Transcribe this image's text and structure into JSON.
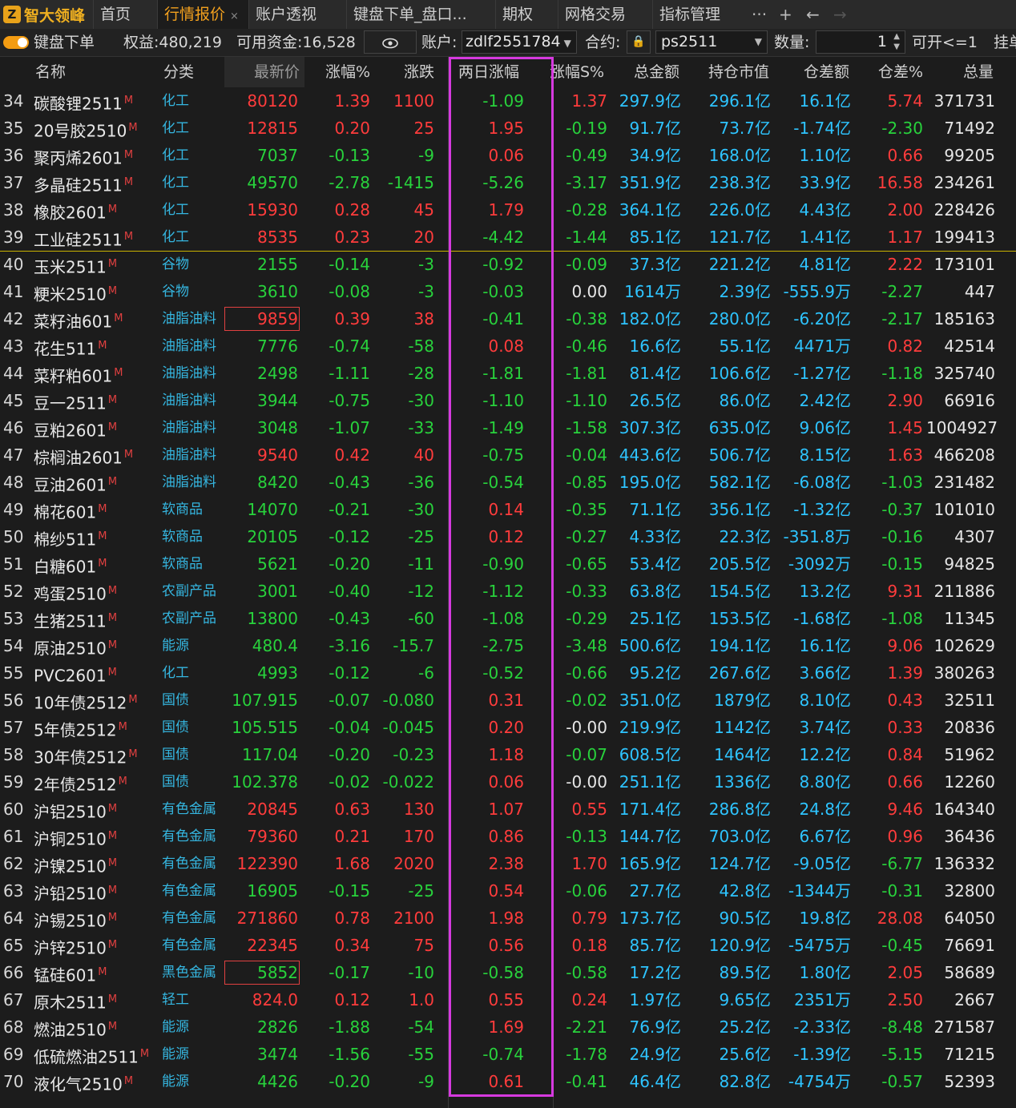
{
  "app": {
    "logo_text": "智大领峰",
    "logo_badge": "Z"
  },
  "tabs": [
    {
      "label": "首页"
    },
    {
      "label": "行情报价",
      "active": true,
      "close": "×"
    },
    {
      "label": "账户透视"
    },
    {
      "label": "键盘下单_盘口..."
    },
    {
      "label": "期权"
    },
    {
      "label": "网格交易"
    },
    {
      "label": "指标管理"
    }
  ],
  "tab_icons": {
    "more": "···",
    "add": "+",
    "back": "←",
    "forward": "→"
  },
  "toolbar": {
    "mode_label": "键盘下单",
    "equity_label": "权益:480,219",
    "available_label": "可用资金:16,528",
    "account_label": "账户:",
    "account_value": "zdlf2551784",
    "contract_label": "合约:",
    "contract_value": "ps2511",
    "qty_label": "数量:",
    "qty_value": "1",
    "open_label": "可开<=1",
    "pending_label": "挂单"
  },
  "columns": [
    "名称",
    "分类",
    "最新价",
    "涨幅%",
    "涨跌",
    "两日涨幅",
    "涨幅S%",
    "总金额",
    "持仓市值",
    "仓差额",
    "仓差%",
    "总量"
  ],
  "rows": [
    {
      "n": "34",
      "name": "碳酸锂2511",
      "m": "M",
      "cat": "化工",
      "price": "80120",
      "pct": "1.39",
      "chg": "1100",
      "two": "-1.09",
      "s": "1.37",
      "amt": "297.9亿",
      "pos": "296.1亿",
      "diff": "16.1亿",
      "dpct": "5.74",
      "vol": "371731"
    },
    {
      "n": "35",
      "name": "20号胶2510",
      "m": "M",
      "cat": "化工",
      "price": "12815",
      "pct": "0.20",
      "chg": "25",
      "two": "1.95",
      "s": "-0.19",
      "amt": "91.7亿",
      "pos": "73.7亿",
      "diff": "-1.74亿",
      "dpct": "-2.30",
      "vol": "71492"
    },
    {
      "n": "36",
      "name": "聚丙烯2601",
      "m": "M",
      "cat": "化工",
      "price": "7037",
      "pct": "-0.13",
      "chg": "-9",
      "two": "0.06",
      "s": "-0.49",
      "amt": "34.9亿",
      "pos": "168.0亿",
      "diff": "1.10亿",
      "dpct": "0.66",
      "vol": "99205"
    },
    {
      "n": "37",
      "name": "多晶硅2511",
      "m": "M",
      "cat": "化工",
      "price": "49570",
      "pct": "-2.78",
      "chg": "-1415",
      "two": "-5.26",
      "s": "-3.17",
      "amt": "351.9亿",
      "pos": "238.3亿",
      "diff": "33.9亿",
      "dpct": "16.58",
      "vol": "234261"
    },
    {
      "n": "38",
      "name": "橡胶2601",
      "m": "M",
      "cat": "化工",
      "price": "15930",
      "pct": "0.28",
      "chg": "45",
      "two": "1.79",
      "s": "-0.28",
      "amt": "364.1亿",
      "pos": "226.0亿",
      "diff": "4.43亿",
      "dpct": "2.00",
      "vol": "228426"
    },
    {
      "n": "39",
      "name": "工业硅2511",
      "m": "M",
      "cat": "化工",
      "price": "8535",
      "pct": "0.23",
      "chg": "20",
      "two": "-4.42",
      "s": "-1.44",
      "amt": "85.1亿",
      "pos": "121.7亿",
      "diff": "1.41亿",
      "dpct": "1.17",
      "vol": "199413"
    },
    {
      "n": "40",
      "name": "玉米2511",
      "m": "M",
      "cat": "谷物",
      "price": "2155",
      "pct": "-0.14",
      "chg": "-3",
      "two": "-0.92",
      "s": "-0.09",
      "amt": "37.3亿",
      "pos": "221.2亿",
      "diff": "4.81亿",
      "dpct": "2.22",
      "vol": "173101"
    },
    {
      "n": "41",
      "name": "粳米2510",
      "m": "M",
      "cat": "谷物",
      "price": "3610",
      "pct": "-0.08",
      "chg": "-3",
      "two": "-0.03",
      "s": "0.00",
      "amt": "1614万",
      "pos": "2.39亿",
      "diff": "-555.9万",
      "dpct": "-2.27",
      "vol": "447"
    },
    {
      "n": "42",
      "name": "菜籽油601",
      "m": "M",
      "cat": "油脂油料",
      "price": "9859",
      "pct": "0.39",
      "chg": "38",
      "two": "-0.41",
      "s": "-0.38",
      "amt": "182.0亿",
      "pos": "280.0亿",
      "diff": "-6.20亿",
      "dpct": "-2.17",
      "vol": "185163"
    },
    {
      "n": "43",
      "name": "花生511",
      "m": "M",
      "cat": "油脂油料",
      "price": "7776",
      "pct": "-0.74",
      "chg": "-58",
      "two": "0.08",
      "s": "-0.46",
      "amt": "16.6亿",
      "pos": "55.1亿",
      "diff": "4471万",
      "dpct": "0.82",
      "vol": "42514"
    },
    {
      "n": "44",
      "name": "菜籽粕601",
      "m": "M",
      "cat": "油脂油料",
      "price": "2498",
      "pct": "-1.11",
      "chg": "-28",
      "two": "-1.81",
      "s": "-1.81",
      "amt": "81.4亿",
      "pos": "106.6亿",
      "diff": "-1.27亿",
      "dpct": "-1.18",
      "vol": "325740"
    },
    {
      "n": "45",
      "name": "豆一2511",
      "m": "M",
      "cat": "油脂油料",
      "price": "3944",
      "pct": "-0.75",
      "chg": "-30",
      "two": "-1.10",
      "s": "-1.10",
      "amt": "26.5亿",
      "pos": "86.0亿",
      "diff": "2.42亿",
      "dpct": "2.90",
      "vol": "66916"
    },
    {
      "n": "46",
      "name": "豆粕2601",
      "m": "M",
      "cat": "油脂油料",
      "price": "3048",
      "pct": "-1.07",
      "chg": "-33",
      "two": "-1.49",
      "s": "-1.58",
      "amt": "307.3亿",
      "pos": "635.0亿",
      "diff": "9.06亿",
      "dpct": "1.45",
      "vol": "1004927"
    },
    {
      "n": "47",
      "name": "棕榈油2601",
      "m": "M",
      "cat": "油脂油料",
      "price": "9540",
      "pct": "0.42",
      "chg": "40",
      "two": "-0.75",
      "s": "-0.04",
      "amt": "443.6亿",
      "pos": "506.7亿",
      "diff": "8.15亿",
      "dpct": "1.63",
      "vol": "466208"
    },
    {
      "n": "48",
      "name": "豆油2601",
      "m": "M",
      "cat": "油脂油料",
      "price": "8420",
      "pct": "-0.43",
      "chg": "-36",
      "two": "-0.54",
      "s": "-0.85",
      "amt": "195.0亿",
      "pos": "582.1亿",
      "diff": "-6.08亿",
      "dpct": "-1.03",
      "vol": "231482"
    },
    {
      "n": "49",
      "name": "棉花601",
      "m": "M",
      "cat": "软商品",
      "price": "14070",
      "pct": "-0.21",
      "chg": "-30",
      "two": "0.14",
      "s": "-0.35",
      "amt": "71.1亿",
      "pos": "356.1亿",
      "diff": "-1.32亿",
      "dpct": "-0.37",
      "vol": "101010"
    },
    {
      "n": "50",
      "name": "棉纱511",
      "m": "M",
      "cat": "软商品",
      "price": "20105",
      "pct": "-0.12",
      "chg": "-25",
      "two": "0.12",
      "s": "-0.27",
      "amt": "4.33亿",
      "pos": "22.3亿",
      "diff": "-351.8万",
      "dpct": "-0.16",
      "vol": "4307"
    },
    {
      "n": "51",
      "name": "白糖601",
      "m": "M",
      "cat": "软商品",
      "price": "5621",
      "pct": "-0.20",
      "chg": "-11",
      "two": "-0.90",
      "s": "-0.65",
      "amt": "53.4亿",
      "pos": "205.5亿",
      "diff": "-3092万",
      "dpct": "-0.15",
      "vol": "94825"
    },
    {
      "n": "52",
      "name": "鸡蛋2510",
      "m": "M",
      "cat": "农副产品",
      "price": "3001",
      "pct": "-0.40",
      "chg": "-12",
      "two": "-1.12",
      "s": "-0.33",
      "amt": "63.8亿",
      "pos": "154.5亿",
      "diff": "13.2亿",
      "dpct": "9.31",
      "vol": "211886"
    },
    {
      "n": "53",
      "name": "生猪2511",
      "m": "M",
      "cat": "农副产品",
      "price": "13800",
      "pct": "-0.43",
      "chg": "-60",
      "two": "-1.08",
      "s": "-0.29",
      "amt": "25.1亿",
      "pos": "153.5亿",
      "diff": "-1.68亿",
      "dpct": "-1.08",
      "vol": "11345"
    },
    {
      "n": "54",
      "name": "原油2510",
      "m": "M",
      "cat": "能源",
      "price": "480.4",
      "pct": "-3.16",
      "chg": "-15.7",
      "two": "-2.75",
      "s": "-3.48",
      "amt": "500.6亿",
      "pos": "194.1亿",
      "diff": "16.1亿",
      "dpct": "9.06",
      "vol": "102629"
    },
    {
      "n": "55",
      "name": "PVC2601",
      "m": "M",
      "cat": "化工",
      "price": "4993",
      "pct": "-0.12",
      "chg": "-6",
      "two": "-0.52",
      "s": "-0.66",
      "amt": "95.2亿",
      "pos": "267.6亿",
      "diff": "3.66亿",
      "dpct": "1.39",
      "vol": "380263"
    },
    {
      "n": "56",
      "name": "10年债2512",
      "m": "M",
      "cat": "国债",
      "price": "107.915",
      "pct": "-0.07",
      "chg": "-0.080",
      "two": "0.31",
      "s": "-0.02",
      "amt": "351.0亿",
      "pos": "1879亿",
      "diff": "8.10亿",
      "dpct": "0.43",
      "vol": "32511"
    },
    {
      "n": "57",
      "name": "5年债2512",
      "m": "M",
      "cat": "国债",
      "price": "105.515",
      "pct": "-0.04",
      "chg": "-0.045",
      "two": "0.20",
      "s": "-0.00",
      "amt": "219.9亿",
      "pos": "1142亿",
      "diff": "3.74亿",
      "dpct": "0.33",
      "vol": "20836"
    },
    {
      "n": "58",
      "name": "30年债2512",
      "m": "M",
      "cat": "国债",
      "price": "117.04",
      "pct": "-0.20",
      "chg": "-0.23",
      "two": "1.18",
      "s": "-0.07",
      "amt": "608.5亿",
      "pos": "1464亿",
      "diff": "12.2亿",
      "dpct": "0.84",
      "vol": "51962"
    },
    {
      "n": "59",
      "name": "2年债2512",
      "m": "M",
      "cat": "国债",
      "price": "102.378",
      "pct": "-0.02",
      "chg": "-0.022",
      "two": "0.06",
      "s": "-0.00",
      "amt": "251.1亿",
      "pos": "1336亿",
      "diff": "8.80亿",
      "dpct": "0.66",
      "vol": "12260"
    },
    {
      "n": "60",
      "name": "沪铝2510",
      "m": "M",
      "cat": "有色金属",
      "price": "20845",
      "pct": "0.63",
      "chg": "130",
      "two": "1.07",
      "s": "0.55",
      "amt": "171.4亿",
      "pos": "286.8亿",
      "diff": "24.8亿",
      "dpct": "9.46",
      "vol": "164340"
    },
    {
      "n": "61",
      "name": "沪铜2510",
      "m": "M",
      "cat": "有色金属",
      "price": "79360",
      "pct": "0.21",
      "chg": "170",
      "two": "0.86",
      "s": "-0.13",
      "amt": "144.7亿",
      "pos": "703.0亿",
      "diff": "6.67亿",
      "dpct": "0.96",
      "vol": "36436"
    },
    {
      "n": "62",
      "name": "沪镍2510",
      "m": "M",
      "cat": "有色金属",
      "price": "122390",
      "pct": "1.68",
      "chg": "2020",
      "two": "2.38",
      "s": "1.70",
      "amt": "165.9亿",
      "pos": "124.7亿",
      "diff": "-9.05亿",
      "dpct": "-6.77",
      "vol": "136332"
    },
    {
      "n": "63",
      "name": "沪铅2510",
      "m": "M",
      "cat": "有色金属",
      "price": "16905",
      "pct": "-0.15",
      "chg": "-25",
      "two": "0.54",
      "s": "-0.06",
      "amt": "27.7亿",
      "pos": "42.8亿",
      "diff": "-1344万",
      "dpct": "-0.31",
      "vol": "32800"
    },
    {
      "n": "64",
      "name": "沪锡2510",
      "m": "M",
      "cat": "有色金属",
      "price": "271860",
      "pct": "0.78",
      "chg": "2100",
      "two": "1.98",
      "s": "0.79",
      "amt": "173.7亿",
      "pos": "90.5亿",
      "diff": "19.8亿",
      "dpct": "28.08",
      "vol": "64050"
    },
    {
      "n": "65",
      "name": "沪锌2510",
      "m": "M",
      "cat": "有色金属",
      "price": "22345",
      "pct": "0.34",
      "chg": "75",
      "two": "0.56",
      "s": "0.18",
      "amt": "85.7亿",
      "pos": "120.9亿",
      "diff": "-5475万",
      "dpct": "-0.45",
      "vol": "76691"
    },
    {
      "n": "66",
      "name": "锰硅601",
      "m": "M",
      "cat": "黑色金属",
      "price": "5852",
      "pct": "-0.17",
      "chg": "-10",
      "two": "-0.58",
      "s": "-0.58",
      "amt": "17.2亿",
      "pos": "89.5亿",
      "diff": "1.80亿",
      "dpct": "2.05",
      "vol": "58689"
    },
    {
      "n": "67",
      "name": "原木2511",
      "m": "M",
      "cat": "轻工",
      "price": "824.0",
      "pct": "0.12",
      "chg": "1.0",
      "two": "0.55",
      "s": "0.24",
      "amt": "1.97亿",
      "pos": "9.65亿",
      "diff": "2351万",
      "dpct": "2.50",
      "vol": "2667"
    },
    {
      "n": "68",
      "name": "燃油2510",
      "m": "M",
      "cat": "能源",
      "price": "2826",
      "pct": "-1.88",
      "chg": "-54",
      "two": "1.69",
      "s": "-2.21",
      "amt": "76.9亿",
      "pos": "25.2亿",
      "diff": "-2.33亿",
      "dpct": "-8.48",
      "vol": "271587"
    },
    {
      "n": "69",
      "name": "低硫燃油2511",
      "m": "M",
      "cat": "能源",
      "price": "3474",
      "pct": "-1.56",
      "chg": "-55",
      "two": "-0.74",
      "s": "-1.78",
      "amt": "24.9亿",
      "pos": "25.6亿",
      "diff": "-1.39亿",
      "dpct": "-5.15",
      "vol": "71215"
    },
    {
      "n": "70",
      "name": "液化气2510",
      "m": "M",
      "cat": "能源",
      "price": "4426",
      "pct": "-0.20",
      "chg": "-9",
      "two": "0.61",
      "s": "-0.41",
      "amt": "46.4亿",
      "pos": "82.8亿",
      "diff": "-4754万",
      "dpct": "-0.57",
      "vol": "52393"
    }
  ]
}
